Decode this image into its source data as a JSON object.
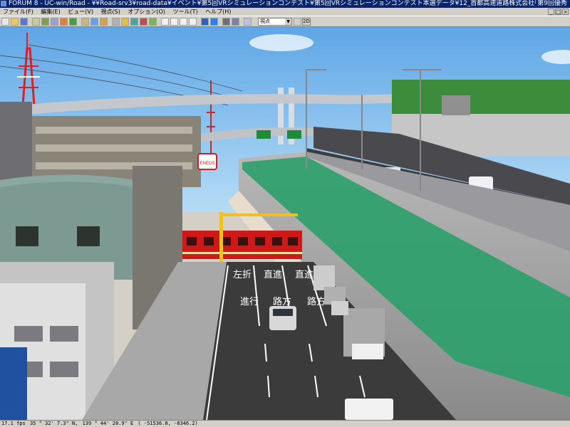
{
  "window": {
    "title": "FORUM 8 - UC-win/Road - ¥¥Road-srv3¥road-data¥イベント¥第5回VRシミュレーションコンテスト¥第5回VRシミュレーションコンテスト本選データ¥12_首都高速道路株式会社¥大師JCT完成形-換気所-DOO-HP用装備位置.rd",
    "right_text": "第9回優秀"
  },
  "menu": {
    "items": [
      "ファイル(F)",
      "編集(E)",
      "ビュー(V)",
      "視点(S)",
      "オプション(O)",
      "ツール(T)",
      "ヘルプ(H)"
    ]
  },
  "toolbar": {
    "view_select_value": "視点",
    "mode_2d_label": "2D"
  },
  "status": {
    "fps": "17.1 fps",
    "latitude": "35 ° 32' 7.3\" N,",
    "longitude": "139 ° 44' 28.9\" E",
    "coords": "( -51536.8, -8346.2)"
  },
  "scene": {
    "signs": [
      "ENEOS"
    ],
    "road_markings": [
      "左折",
      "直進",
      "直進",
      "進行",
      "路方",
      "路方"
    ],
    "colors": {
      "sky": "#8fc8f0",
      "asphalt": "#3b3b3b",
      "tram": "#d01818",
      "green_panel": "#2aa06a",
      "building_green": "#3c8c3c"
    }
  }
}
